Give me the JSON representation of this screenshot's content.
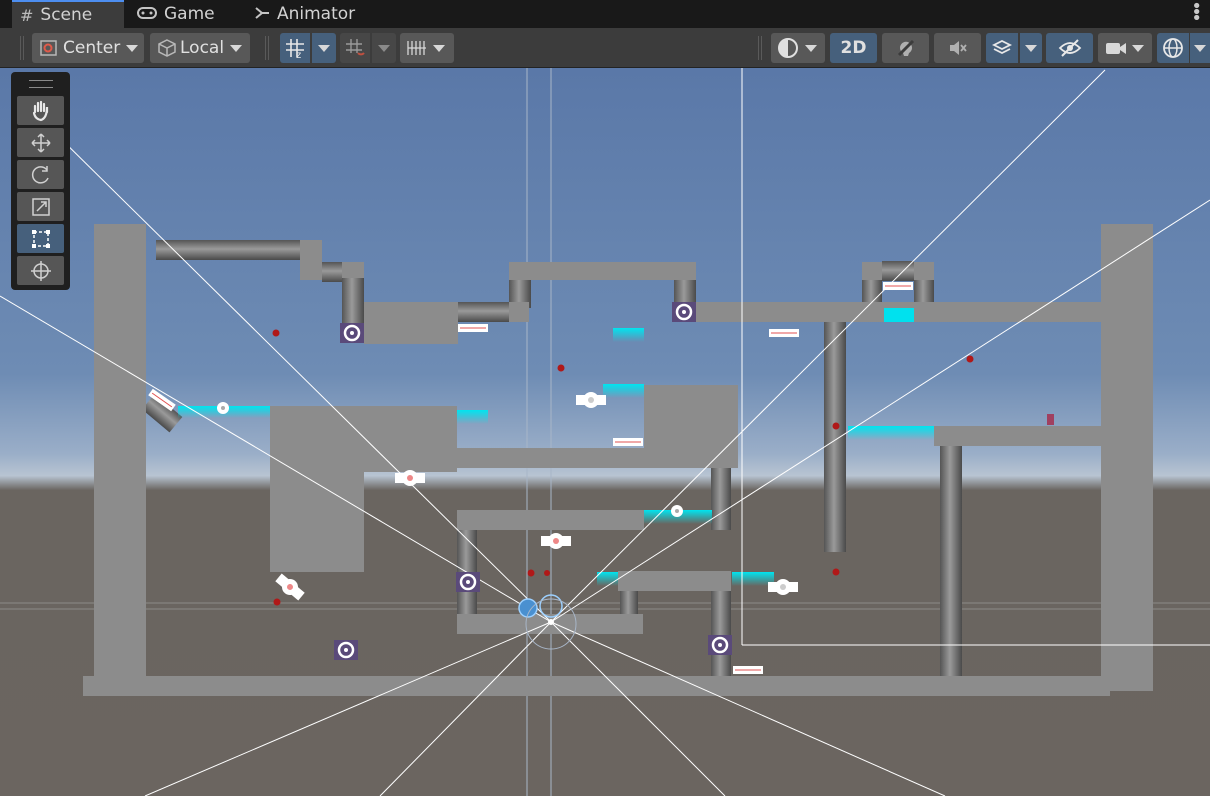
{
  "tabs": [
    {
      "label": "Scene",
      "icon": "hash-icon",
      "active": true
    },
    {
      "label": "Game",
      "icon": "gamepad-icon",
      "active": false
    },
    {
      "label": "Animator",
      "icon": "animator-icon",
      "active": false
    }
  ],
  "toolbar": {
    "pivot_label": "Center",
    "space_label": "Local",
    "mode_2d_label": "2D"
  },
  "tools": [
    "hand-tool",
    "move-tool",
    "rotate-tool",
    "scale-tool",
    "rect-tool",
    "transform-tool"
  ],
  "active_tool": "rect-tool",
  "colors": {
    "sky_top": "#5a78a8",
    "horizon": "#aabbd0",
    "ground": "#6b6560",
    "platform": "#8c8c8c",
    "water": "#00e1ee",
    "accent": "#46607c"
  }
}
